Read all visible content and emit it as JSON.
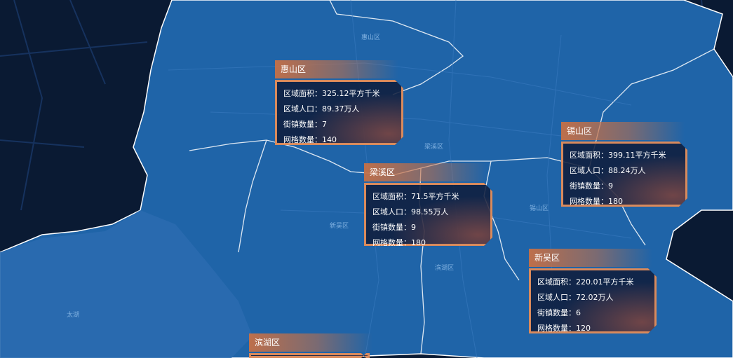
{
  "map": {
    "background_color": "#0a1a33",
    "region_color": "#1f64a8",
    "lake_color": "#2a6aaf",
    "boundary_color": "#ffffff",
    "road_color": "#11264a",
    "place_labels": [
      "惠山区",
      "锡山区",
      "滨湖区",
      "新吴区",
      "太湖",
      "梁溪区"
    ]
  },
  "popup_style": {
    "title_color": "#c67046",
    "border_color": "#d98a5c",
    "text_color": "#ffffff"
  },
  "districts": [
    {
      "id": "huishan",
      "name": "惠山区",
      "fields": [
        {
          "label": "区域面积：",
          "value": "325.12平方千米"
        },
        {
          "label": "区域人口：",
          "value": "89.37万人"
        },
        {
          "label": "街镇数量：",
          "value": "7"
        },
        {
          "label": "网格数量：",
          "value": "140"
        }
      ]
    },
    {
      "id": "xishan",
      "name": "锡山区",
      "fields": [
        {
          "label": "区域面积：",
          "value": "399.11平方千米"
        },
        {
          "label": "区域人口：",
          "value": "88.24万人"
        },
        {
          "label": "街镇数量：",
          "value": "9"
        },
        {
          "label": "网格数量：",
          "value": "180"
        }
      ]
    },
    {
      "id": "liangxi",
      "name": "梁溪区",
      "fields": [
        {
          "label": "区域面积：",
          "value": "71.5平方千米"
        },
        {
          "label": "区域人口：",
          "value": "98.55万人"
        },
        {
          "label": "街镇数量：",
          "value": "9"
        },
        {
          "label": "网格数量：",
          "value": "180"
        }
      ]
    },
    {
      "id": "xinwu",
      "name": "新吴区",
      "fields": [
        {
          "label": "区域面积：",
          "value": "220.01平方千米"
        },
        {
          "label": "区域人口：",
          "value": "72.02万人"
        },
        {
          "label": "街镇数量：",
          "value": "6"
        },
        {
          "label": "网格数量：",
          "value": "120"
        }
      ]
    },
    {
      "id": "binhu",
      "name": "滨湖区",
      "fields": []
    }
  ]
}
